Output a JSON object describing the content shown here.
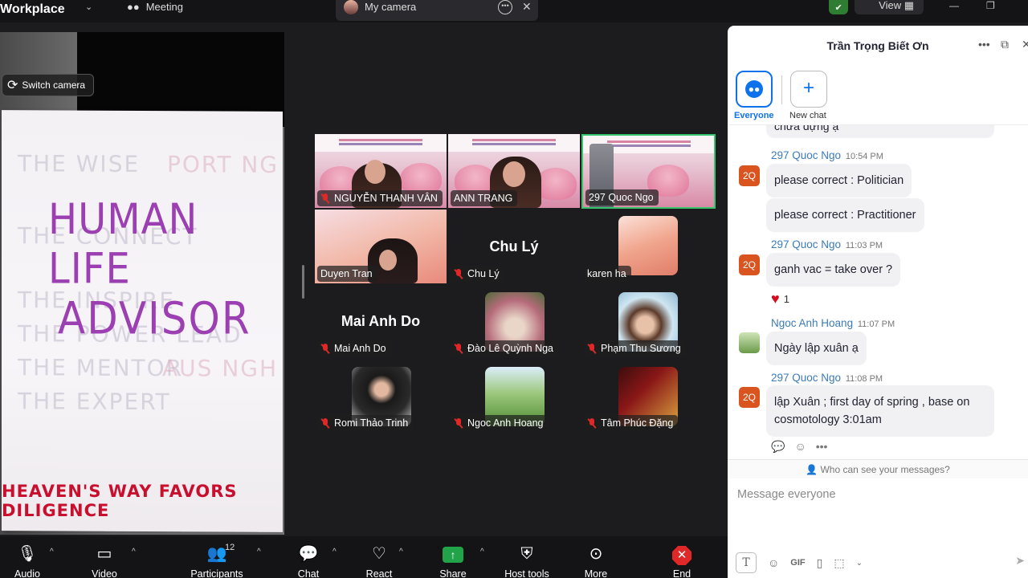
{
  "topbar": {
    "app_name": "Workplace",
    "meeting_tab": "Meeting",
    "camera_tab": "My camera",
    "view_label": "View"
  },
  "camera": {
    "switch_label": "Switch camera",
    "paper_line1": "HUMAN LIFE",
    "paper_line2": "ADVISOR",
    "paper_line3": "HEAVEN'S WAY FAVORS DILIGENCE"
  },
  "grid": {
    "tiles": [
      {
        "name": "NGUYỄN THANH VÂN"
      },
      {
        "name": "ANN TRANG"
      },
      {
        "name": "297 Quoc Ngo"
      },
      {
        "name": "Duyen Tran"
      },
      {
        "name": "Chu Lý",
        "center": "Chu Lý"
      },
      {
        "name": "karen ha"
      },
      {
        "name": "Mai Anh Do",
        "center": "Mai Anh Do"
      },
      {
        "name": "Đào Lê Quỳnh Nga"
      },
      {
        "name": "Phạm Thu Sương"
      },
      {
        "name": "Romi Thảo Trinh"
      },
      {
        "name": "Ngoc Anh Hoang"
      },
      {
        "name": "Tâm Phúc Đặng"
      }
    ]
  },
  "chat": {
    "title": "Trần Trọng Biết Ơn",
    "tab_everyone": "Everyone",
    "tab_new_chat": "New chat",
    "partial_top": "chưa dựng ạ",
    "messages": [
      {
        "avatar": "2Q",
        "sender": "297 Quoc Ngo",
        "time": "10:54 PM",
        "text1": "please correct : Politician",
        "text2": "please correct : Practitioner"
      },
      {
        "avatar": "2Q",
        "sender": "297 Quoc Ngo",
        "time": "11:03 PM",
        "text1": "ganh vac = take over ?",
        "reaction_count": "1"
      },
      {
        "sender": "Ngoc Anh Hoang",
        "time": "11:07 PM",
        "text1": "Ngày lập xuân ạ"
      },
      {
        "avatar": "2Q",
        "sender": "297 Quoc Ngo",
        "time": "11:08 PM",
        "text1": "lập Xuân ; first day of spring , base on cosmotology 3:01am"
      }
    ],
    "who_can_see": "Who can see your messages?",
    "input_placeholder": "Message everyone",
    "gif_label": "GIF"
  },
  "toolbar": {
    "audio": "Audio",
    "video": "Video",
    "participants": "Participants",
    "participants_count": "12",
    "chat": "Chat",
    "react": "React",
    "share": "Share",
    "host_tools": "Host tools",
    "more": "More",
    "end": "End"
  },
  "colors": {
    "accent": "#0e72ed",
    "active_speaker": "#36c46e",
    "end_red": "#e02828",
    "share_green": "#21a34a"
  }
}
